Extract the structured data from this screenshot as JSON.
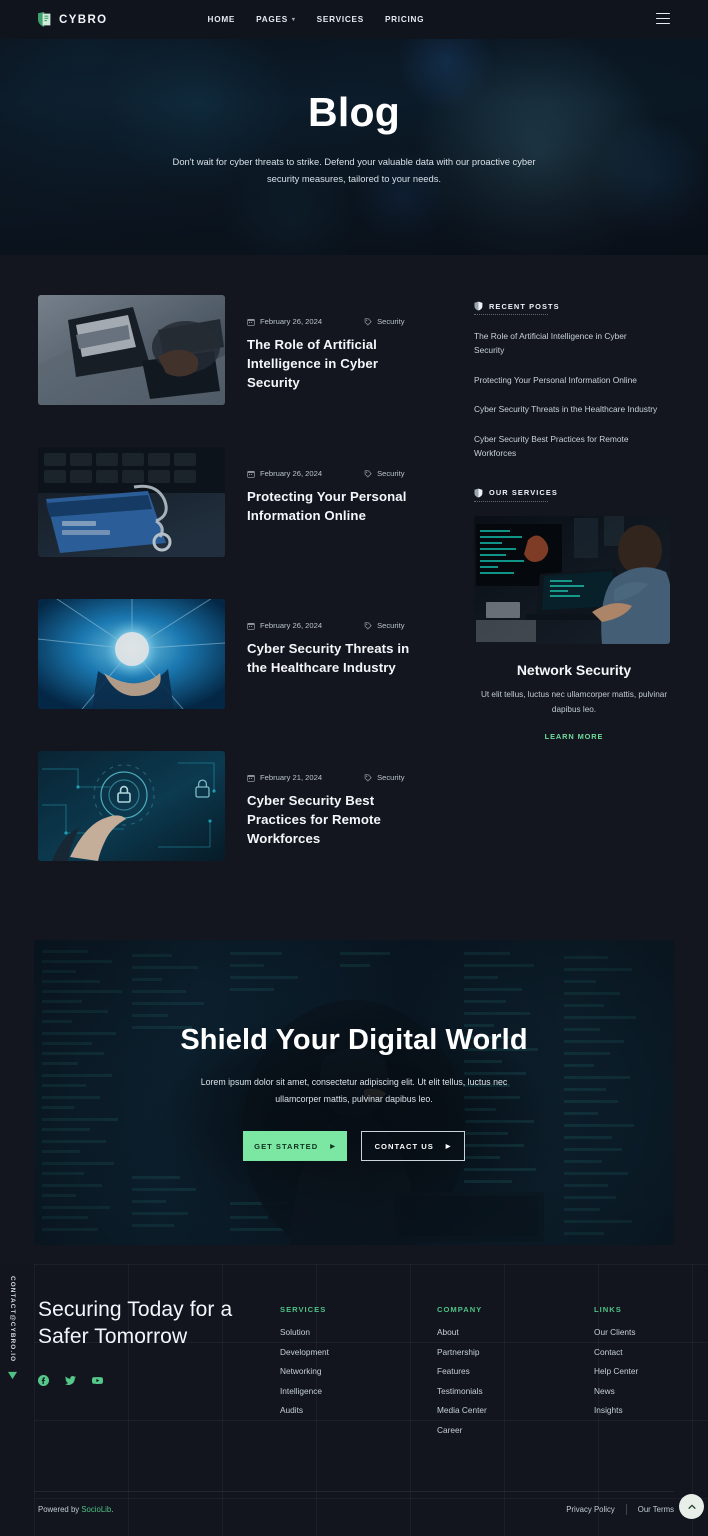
{
  "header": {
    "logo_text": "CYBRO",
    "logo_icon": "shield-document-icon",
    "nav": [
      {
        "label": "HOME",
        "has_caret": false
      },
      {
        "label": "PAGES",
        "has_caret": true
      },
      {
        "label": "SERVICES",
        "has_caret": false
      },
      {
        "label": "PRICING",
        "has_caret": false
      }
    ],
    "menu_icon": "hamburger-icon"
  },
  "hero": {
    "title": "Blog",
    "subtitle": "Don't wait for cyber threats to strike. Defend your valuable data with our proactive cyber security measures, tailored to your needs."
  },
  "posts": [
    {
      "date": "February 26, 2024",
      "category": "Security",
      "title": "The Role of Artificial Intelligence in Cyber Security",
      "image_alt": "person typing on laptop with data on screen"
    },
    {
      "date": "February 26, 2024",
      "category": "Security",
      "title": "Protecting Your Personal Information Online",
      "image_alt": "credit card with chain and padlock on keyboard"
    },
    {
      "date": "February 26, 2024",
      "category": "Security",
      "title": "Cyber Security Threats in the Healthcare Industry",
      "image_alt": "hand holding glowing digital sphere"
    },
    {
      "date": "February 21, 2024",
      "category": "Security",
      "title": "Cyber Security Best Practices for Remote Workforces",
      "image_alt": "hand touching digital security network interface"
    }
  ],
  "sidebar": {
    "recent_posts_heading": "RECENT POSTS",
    "recent_posts": [
      "The Role of Artificial Intelligence in Cyber Security",
      "Protecting Your Personal Information Online",
      "Cyber Security Threats in the Healthcare Industry",
      "Cyber Security Best Practices for Remote Workforces"
    ],
    "services_heading": "OUR SERVICES",
    "service_card": {
      "title": "Network Security",
      "description": "Ut elit tellus, luctus nec ullamcorper mattis, pulvinar dapibus leo.",
      "link_label": "LEARN MORE",
      "image_alt": "man at desk with monitors showing code"
    }
  },
  "cta": {
    "title": "Shield Your Digital World",
    "subtitle": "Lorem ipsum dolor sit amet, consectetur adipiscing elit. Ut elit tellus, luctus nec ullamcorper mattis, pulvinar dapibus leo.",
    "primary_button": "GET STARTED",
    "secondary_button": "CONTACT US",
    "image_alt": "hooded person at laptop with code overlay"
  },
  "side_contact": {
    "text": "CONTACT@CYBRO.IO",
    "icon": "send-arrow-icon"
  },
  "footer": {
    "tagline": "Securing Today for a Safer Tomorrow",
    "social": [
      {
        "name": "facebook-icon"
      },
      {
        "name": "twitter-icon"
      },
      {
        "name": "youtube-icon"
      }
    ],
    "columns": [
      {
        "heading": "SERVICES",
        "links": [
          "Solution",
          "Development",
          "Networking",
          "Intelligence",
          "Audits"
        ]
      },
      {
        "heading": "COMPANY",
        "links": [
          "About",
          "Partnership",
          "Features",
          "Testimonials",
          "Media Center",
          "Career"
        ]
      },
      {
        "heading": "LINKS",
        "links": [
          "Our Clients",
          "Contact",
          "Help Center",
          "News",
          "Insights"
        ]
      }
    ],
    "powered_prefix": "Powered by ",
    "powered_brand": "SocioLib",
    "powered_suffix": ".",
    "legal": [
      "Privacy Policy",
      "Our Terms"
    ],
    "to_top_icon": "chevron-up-icon"
  },
  "colors": {
    "accent_green": "#4fc185",
    "button_green": "#7ce6a3",
    "page_bg": "#13161f",
    "header_bg": "#10141c"
  }
}
